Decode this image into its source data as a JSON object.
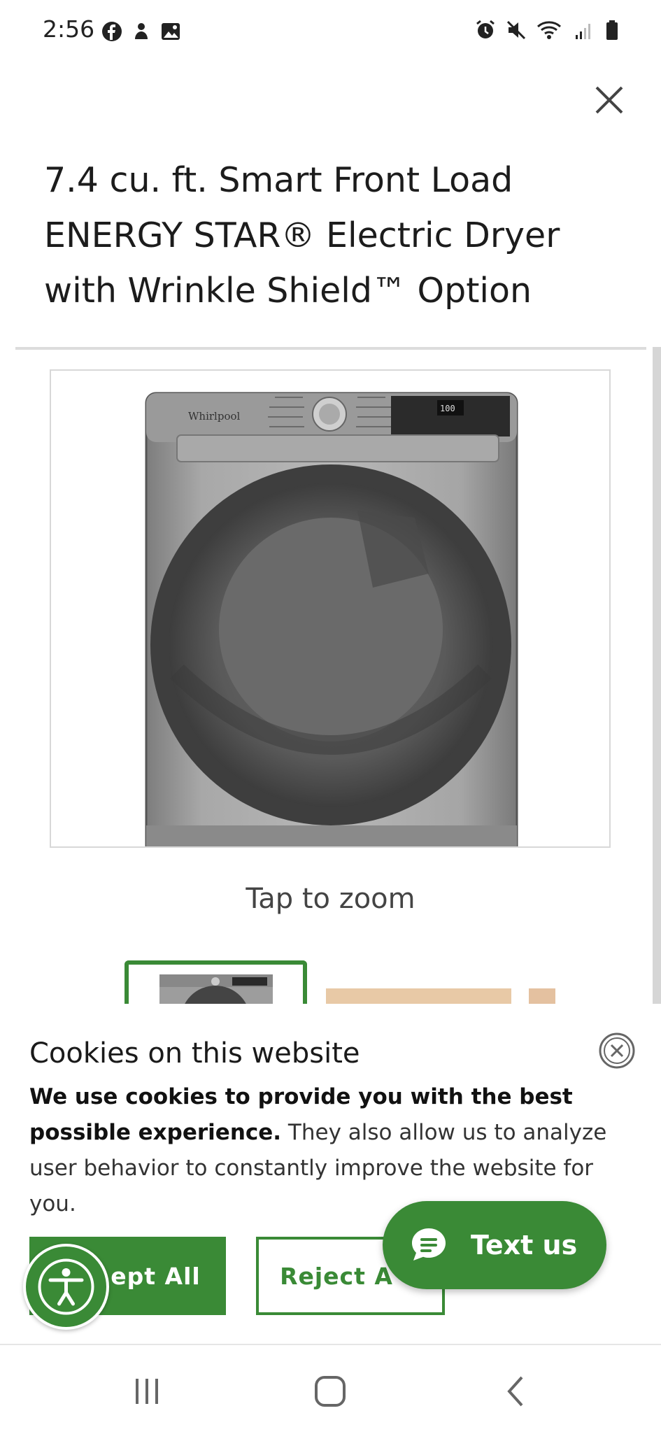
{
  "status_bar": {
    "time": "2:56",
    "left_icons": [
      "facebook-icon",
      "notification-icon",
      "gallery-icon"
    ],
    "right_icons": [
      "alarm-icon",
      "mute-icon",
      "wifi-icon",
      "signal-icon",
      "battery-icon"
    ]
  },
  "product": {
    "title": "7.4 cu. ft. Smart Front Load ENERGY STAR® Electric Dryer with Wrinkle Shield™ Option",
    "brand_on_image": "Whirlpool",
    "display_value": "100",
    "zoom_hint": "Tap to zoom"
  },
  "cookie_banner": {
    "title": "Cookies on this website",
    "body_bold": "We use cookies to provide you with the best possible experience.",
    "body_rest": " They also allow us to analyze user behavior to constantly improve the website for you.",
    "accept_label": "ept All",
    "reject_label": "Reject A"
  },
  "chat_button": {
    "label": "Text us"
  },
  "colors": {
    "accent_green": "#3a8a36"
  }
}
